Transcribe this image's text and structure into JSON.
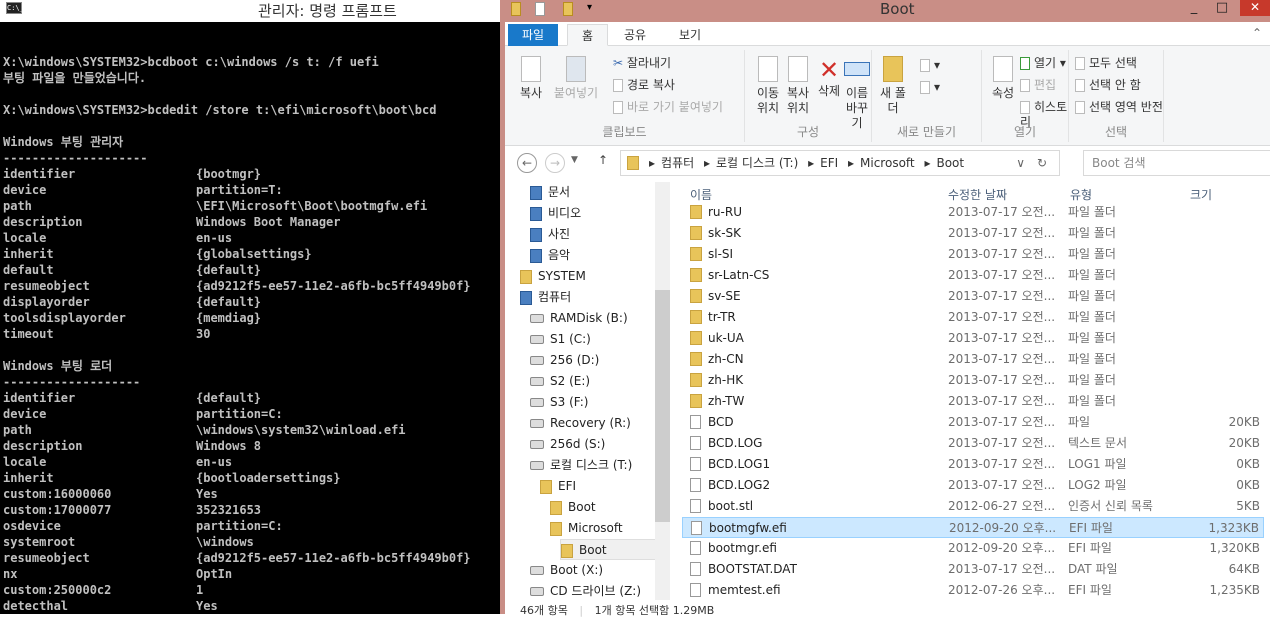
{
  "cmd": {
    "title": "관리자: 명령 프롬프트",
    "icon": "C:\\_",
    "lines": [
      {
        "k": ""
      },
      {
        "k": "X:\\windows\\SYSTEM32>bcdboot c:\\windows /s t: /f uefi"
      },
      {
        "k": "부팅 파일을 만들었습니다."
      },
      {
        "k": ""
      },
      {
        "k": "X:\\windows\\SYSTEM32>bcdedit /store t:\\efi\\microsoft\\boot\\bcd"
      },
      {
        "k": ""
      },
      {
        "k": "Windows 부팅 관리자"
      },
      {
        "k": "--------------------"
      },
      {
        "k": "identifier",
        "v": "{bootmgr}"
      },
      {
        "k": "device",
        "v": "partition=T:"
      },
      {
        "k": "path",
        "v": "\\EFI\\Microsoft\\Boot\\bootmgfw.efi"
      },
      {
        "k": "description",
        "v": "Windows Boot Manager"
      },
      {
        "k": "locale",
        "v": "en-us"
      },
      {
        "k": "inherit",
        "v": "{globalsettings}"
      },
      {
        "k": "default",
        "v": "{default}"
      },
      {
        "k": "resumeobject",
        "v": "{ad9212f5-ee57-11e2-a6fb-bc5ff4949b0f}"
      },
      {
        "k": "displayorder",
        "v": "{default}"
      },
      {
        "k": "toolsdisplayorder",
        "v": "{memdiag}"
      },
      {
        "k": "timeout",
        "v": "30"
      },
      {
        "k": ""
      },
      {
        "k": "Windows 부팅 로더"
      },
      {
        "k": "-------------------"
      },
      {
        "k": "identifier",
        "v": "{default}"
      },
      {
        "k": "device",
        "v": "partition=C:"
      },
      {
        "k": "path",
        "v": "\\windows\\system32\\winload.efi"
      },
      {
        "k": "description",
        "v": "Windows 8"
      },
      {
        "k": "locale",
        "v": "en-us"
      },
      {
        "k": "inherit",
        "v": "{bootloadersettings}"
      },
      {
        "k": "custom:16000060",
        "v": "Yes"
      },
      {
        "k": "custom:17000077",
        "v": "352321653"
      },
      {
        "k": "osdevice",
        "v": "partition=C:"
      },
      {
        "k": "systemroot",
        "v": "\\windows"
      },
      {
        "k": "resumeobject",
        "v": "{ad9212f5-ee57-11e2-a6fb-bc5ff4949b0f}"
      },
      {
        "k": "nx",
        "v": "OptIn"
      },
      {
        "k": "custom:250000c2",
        "v": "1"
      },
      {
        "k": "detecthal",
        "v": "Yes"
      }
    ]
  },
  "explorer": {
    "title": "Boot",
    "minimize": "_",
    "maximize": "□",
    "close": "✕",
    "tabs": [
      "파일",
      "홈",
      "공유",
      "보기"
    ],
    "ribbon": {
      "clipboard": {
        "label": "클립보드",
        "copy": "복사",
        "paste": "붙여넣기",
        "cut": "잘라내기",
        "copy_path": "경로 복사",
        "paste_shortcut": "바로 가기 붙여넣기"
      },
      "organize": {
        "label": "구성",
        "move_to": "이동 위치",
        "copy_to": "복사 위치",
        "delete": "삭제",
        "rename": "이름 바꾸기"
      },
      "new": {
        "label": "새로 만들기",
        "new_folder": "새 폴더"
      },
      "open": {
        "label": "열기",
        "properties": "속성",
        "open": "열기",
        "edit": "편집",
        "history": "히스토리"
      },
      "select": {
        "label": "선택",
        "select_all": "모두 선택",
        "select_none": "선택 안 함",
        "invert": "선택 영역 반전"
      }
    },
    "breadcrumb": [
      "컴퓨터",
      "로컬 디스크 (T:)",
      "EFI",
      "Microsoft",
      "Boot"
    ],
    "search_placeholder": "Boot 검색",
    "nav": [
      {
        "label": "문서",
        "type": "lib",
        "indent": 2
      },
      {
        "label": "비디오",
        "type": "lib",
        "indent": 2
      },
      {
        "label": "사진",
        "type": "lib",
        "indent": 2
      },
      {
        "label": "음악",
        "type": "lib",
        "indent": 2
      },
      {
        "label": "SYSTEM",
        "type": "folder",
        "indent": 1
      },
      {
        "label": "컴퓨터",
        "type": "pc",
        "indent": 1
      },
      {
        "label": "RAMDisk (B:)",
        "type": "drive",
        "indent": 2
      },
      {
        "label": "S1 (C:)",
        "type": "drive",
        "indent": 2
      },
      {
        "label": "256 (D:)",
        "type": "drive",
        "indent": 2
      },
      {
        "label": "S2 (E:)",
        "type": "drive",
        "indent": 2
      },
      {
        "label": "S3 (F:)",
        "type": "drive",
        "indent": 2
      },
      {
        "label": "Recovery (R:)",
        "type": "drive",
        "indent": 2
      },
      {
        "label": "256d (S:)",
        "type": "drive",
        "indent": 2
      },
      {
        "label": "로컬 디스크 (T:)",
        "type": "drive",
        "indent": 2
      },
      {
        "label": "EFI",
        "type": "folder",
        "indent": 3
      },
      {
        "label": "Boot",
        "type": "folder",
        "indent": 4
      },
      {
        "label": "Microsoft",
        "type": "folder",
        "indent": 4
      },
      {
        "label": "Boot",
        "type": "folder",
        "indent": 5,
        "selected": true
      },
      {
        "label": "Boot (X:)",
        "type": "drive",
        "indent": 2
      },
      {
        "label": "CD 드라이브 (Z:)",
        "type": "drive",
        "indent": 2
      }
    ],
    "columns": [
      "이름",
      "수정한 날짜",
      "유형",
      "크기"
    ],
    "files": [
      {
        "name": "ru-RU",
        "date": "2013-07-17 오전...",
        "type": "파일 폴더",
        "size": "",
        "kind": "folder"
      },
      {
        "name": "sk-SK",
        "date": "2013-07-17 오전...",
        "type": "파일 폴더",
        "size": "",
        "kind": "folder"
      },
      {
        "name": "sl-SI",
        "date": "2013-07-17 오전...",
        "type": "파일 폴더",
        "size": "",
        "kind": "folder"
      },
      {
        "name": "sr-Latn-CS",
        "date": "2013-07-17 오전...",
        "type": "파일 폴더",
        "size": "",
        "kind": "folder"
      },
      {
        "name": "sv-SE",
        "date": "2013-07-17 오전...",
        "type": "파일 폴더",
        "size": "",
        "kind": "folder"
      },
      {
        "name": "tr-TR",
        "date": "2013-07-17 오전...",
        "type": "파일 폴더",
        "size": "",
        "kind": "folder"
      },
      {
        "name": "uk-UA",
        "date": "2013-07-17 오전...",
        "type": "파일 폴더",
        "size": "",
        "kind": "folder"
      },
      {
        "name": "zh-CN",
        "date": "2013-07-17 오전...",
        "type": "파일 폴더",
        "size": "",
        "kind": "folder"
      },
      {
        "name": "zh-HK",
        "date": "2013-07-17 오전...",
        "type": "파일 폴더",
        "size": "",
        "kind": "folder"
      },
      {
        "name": "zh-TW",
        "date": "2013-07-17 오전...",
        "type": "파일 폴더",
        "size": "",
        "kind": "folder"
      },
      {
        "name": "BCD",
        "date": "2013-07-17 오전...",
        "type": "파일",
        "size": "20KB",
        "kind": "file"
      },
      {
        "name": "BCD.LOG",
        "date": "2013-07-17 오전...",
        "type": "텍스트 문서",
        "size": "20KB",
        "kind": "file"
      },
      {
        "name": "BCD.LOG1",
        "date": "2013-07-17 오전...",
        "type": "LOG1 파일",
        "size": "0KB",
        "kind": "file"
      },
      {
        "name": "BCD.LOG2",
        "date": "2013-07-17 오전...",
        "type": "LOG2 파일",
        "size": "0KB",
        "kind": "file"
      },
      {
        "name": "boot.stl",
        "date": "2012-06-27 오전...",
        "type": "인증서 신뢰 목록",
        "size": "5KB",
        "kind": "file"
      },
      {
        "name": "bootmgfw.efi",
        "date": "2012-09-20 오후...",
        "type": "EFI 파일",
        "size": "1,323KB",
        "kind": "file",
        "selected": true
      },
      {
        "name": "bootmgr.efi",
        "date": "2012-09-20 오후...",
        "type": "EFI 파일",
        "size": "1,320KB",
        "kind": "file"
      },
      {
        "name": "BOOTSTAT.DAT",
        "date": "2013-07-17 오전...",
        "type": "DAT 파일",
        "size": "64KB",
        "kind": "file"
      },
      {
        "name": "memtest.efi",
        "date": "2012-07-26 오후...",
        "type": "EFI 파일",
        "size": "1,235KB",
        "kind": "file"
      }
    ],
    "status": {
      "count": "46개 항목",
      "selection": "1개 항목 선택함 1.29MB"
    },
    "accent": "#1979ca",
    "title_color": "#c98e86"
  }
}
